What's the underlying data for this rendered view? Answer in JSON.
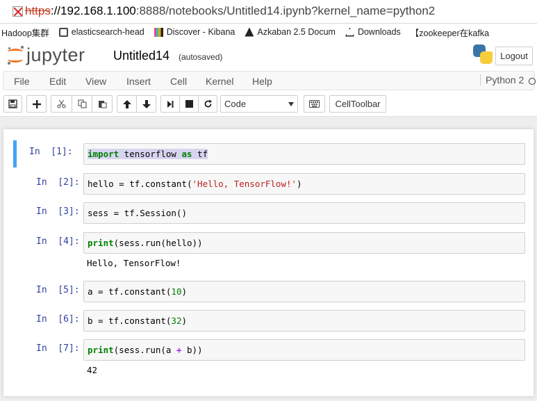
{
  "browser": {
    "url_scheme": "https",
    "url_host": "://192.168.1.100",
    "url_rest": ":8888/notebooks/Untitled14.ipynb?kernel_name=python2",
    "bookmarks": [
      {
        "label": "Hadoop集群",
        "icon": "none"
      },
      {
        "label": "elasticsearch-head",
        "icon": "elasticsearch-icon"
      },
      {
        "label": "Discover - Kibana",
        "icon": "kibana-icon"
      },
      {
        "label": "Azkaban 2.5 Docum",
        "icon": "azkaban-icon"
      },
      {
        "label": "Downloads",
        "icon": "downloads-icon"
      },
      {
        "label": "【zookeeper在kafka",
        "icon": "none"
      }
    ]
  },
  "header": {
    "logo_text": "jupyter",
    "notebook_name": "Untitled14",
    "save_status": "(autosaved)",
    "logout_label": "Logout"
  },
  "menu": {
    "items": [
      "File",
      "Edit",
      "View",
      "Insert",
      "Cell",
      "Kernel",
      "Help"
    ],
    "kernel_name": "Python 2"
  },
  "toolbar": {
    "cell_type": "Code",
    "celltoolbar_label": "CellToolbar"
  },
  "cells": [
    {
      "prompt": "In  [1]:",
      "code_parts": [
        {
          "t": "import",
          "c": "kw"
        },
        {
          "t": " tensorflow ",
          "c": ""
        },
        {
          "t": "as",
          "c": "kw"
        },
        {
          "t": " tf",
          "c": ""
        }
      ],
      "output": ""
    },
    {
      "prompt": "In  [2]:",
      "code_parts": [
        {
          "t": "hello = tf.constant(",
          "c": ""
        },
        {
          "t": "'Hello, TensorFlow!'",
          "c": "str"
        },
        {
          "t": ")",
          "c": ""
        }
      ],
      "output": ""
    },
    {
      "prompt": "In  [3]:",
      "code_parts": [
        {
          "t": "sess = tf.Session()",
          "c": ""
        }
      ],
      "output": ""
    },
    {
      "prompt": "In  [4]:",
      "code_parts": [
        {
          "t": "print",
          "c": "kw"
        },
        {
          "t": "(sess.run(hello))",
          "c": ""
        }
      ],
      "output": "Hello, TensorFlow!"
    },
    {
      "prompt": "In  [5]:",
      "code_parts": [
        {
          "t": "a = tf.constant(",
          "c": ""
        },
        {
          "t": "10",
          "c": "num"
        },
        {
          "t": ")",
          "c": ""
        }
      ],
      "output": ""
    },
    {
      "prompt": "In  [6]:",
      "code_parts": [
        {
          "t": "b = tf.constant(",
          "c": ""
        },
        {
          "t": "32",
          "c": "num"
        },
        {
          "t": ")",
          "c": ""
        }
      ],
      "output": ""
    },
    {
      "prompt": "In  [7]:",
      "code_parts": [
        {
          "t": "print",
          "c": "kw"
        },
        {
          "t": "(sess.run(a ",
          "c": ""
        },
        {
          "t": "+",
          "c": "op"
        },
        {
          "t": " b))",
          "c": ""
        }
      ],
      "output": "42"
    }
  ],
  "colors": {
    "jupyter_orange": "#f37626",
    "prompt_blue": "#303f9f",
    "selected_cell_bar": "#42a5f5",
    "keyword_green": "#008000",
    "string_red": "#ba2121"
  }
}
